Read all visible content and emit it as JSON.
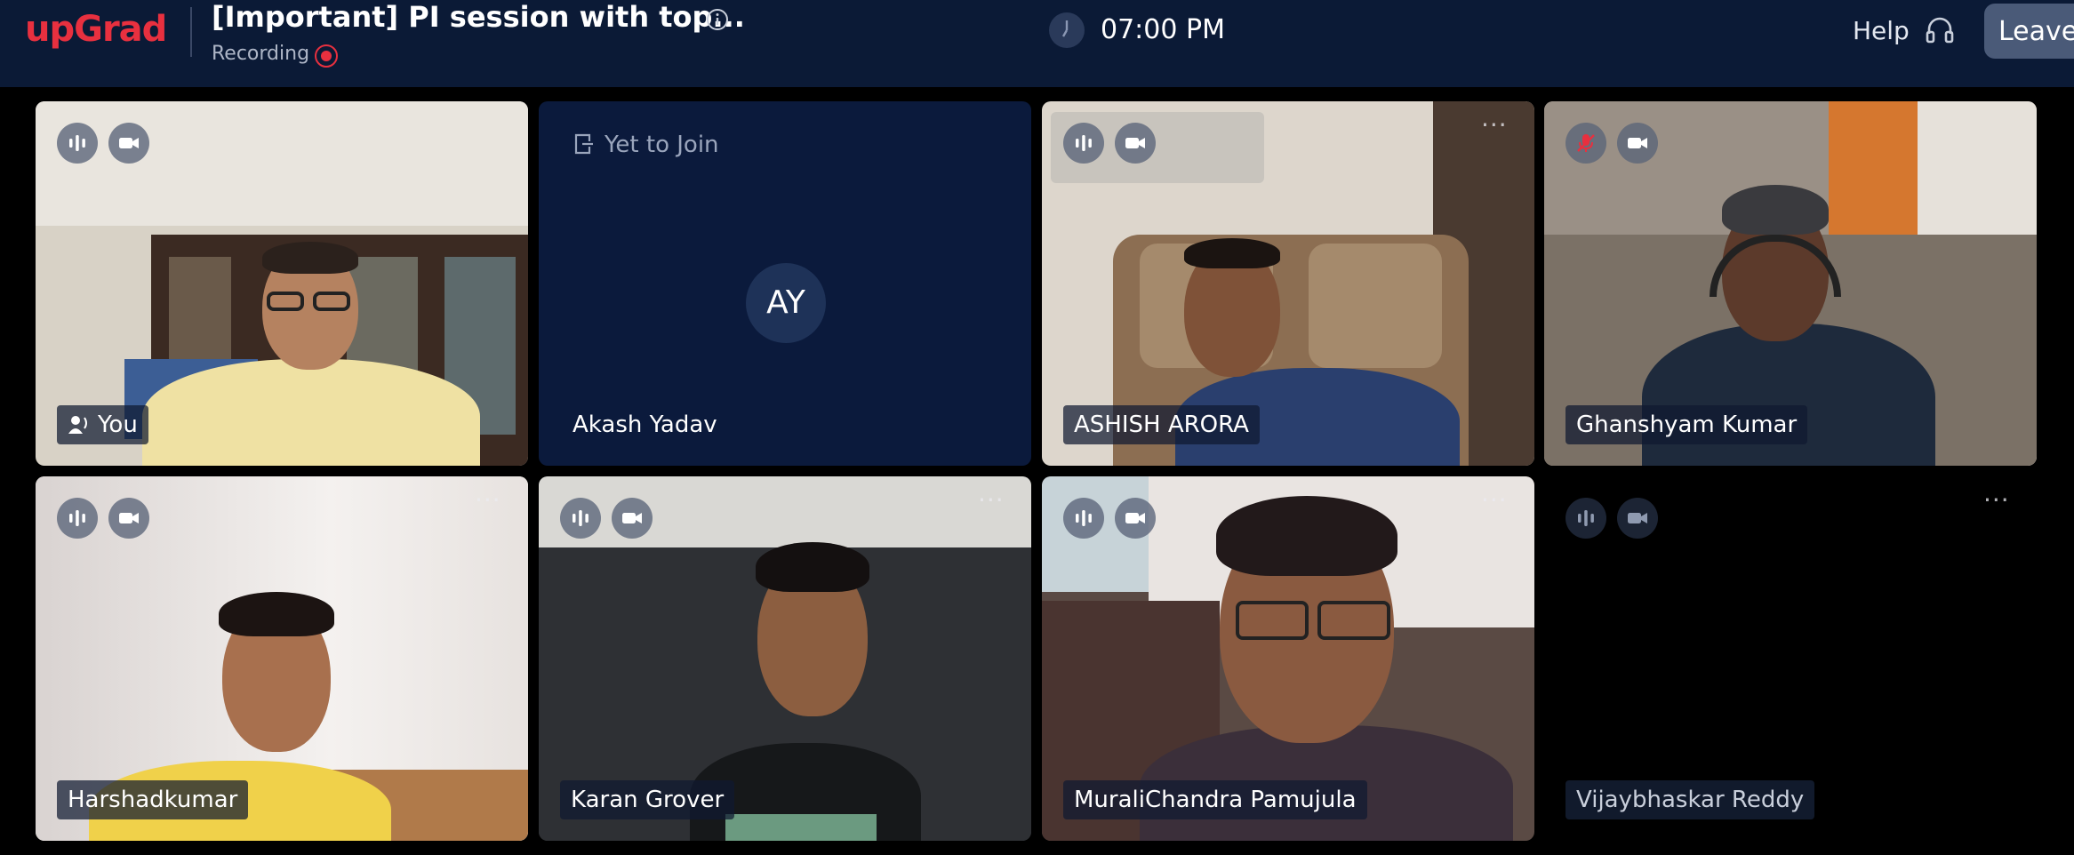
{
  "header": {
    "logo": "upGrad",
    "title": "[Important] PI session with top...",
    "recording_label": "Recording",
    "time": "07:00 PM",
    "help_label": "Help",
    "leave_label": "Leave"
  },
  "colors": {
    "header_bg": "#0b1a36",
    "brand_red": "#e8303f",
    "tile_empty_bg": "#0b1a3c",
    "page_bg": "#000000"
  },
  "tiles": [
    {
      "name": "You",
      "mic": "on",
      "camera": "on",
      "video": true,
      "self": true
    },
    {
      "name": "Akash Yadav",
      "status": "Yet to Join",
      "initials": "AY",
      "video": false
    },
    {
      "name": "ASHISH ARORA",
      "mic": "on",
      "camera": "on",
      "video": true,
      "more_menu": true
    },
    {
      "name": "Ghanshyam Kumar",
      "mic": "muted",
      "camera": "on",
      "video": true
    },
    {
      "name": "Harshadkumar",
      "mic": "on",
      "camera": "on",
      "video": true,
      "more_menu": true
    },
    {
      "name": "Karan Grover",
      "mic": "on",
      "camera": "on",
      "video": true,
      "more_menu": true
    },
    {
      "name": "MuraliChandra Pamujula",
      "mic": "on",
      "camera": "on",
      "video": true,
      "more_menu": true
    },
    {
      "name": "Vijaybhaskar Reddy",
      "mic": "on",
      "camera": "on",
      "video": false,
      "more_menu": true
    }
  ],
  "icons": [
    "info-icon",
    "record-icon",
    "clock-icon",
    "headset-icon",
    "mic-icon",
    "mic-muted-icon",
    "camera-icon",
    "more-icon",
    "speaker-icon",
    "join-icon"
  ]
}
